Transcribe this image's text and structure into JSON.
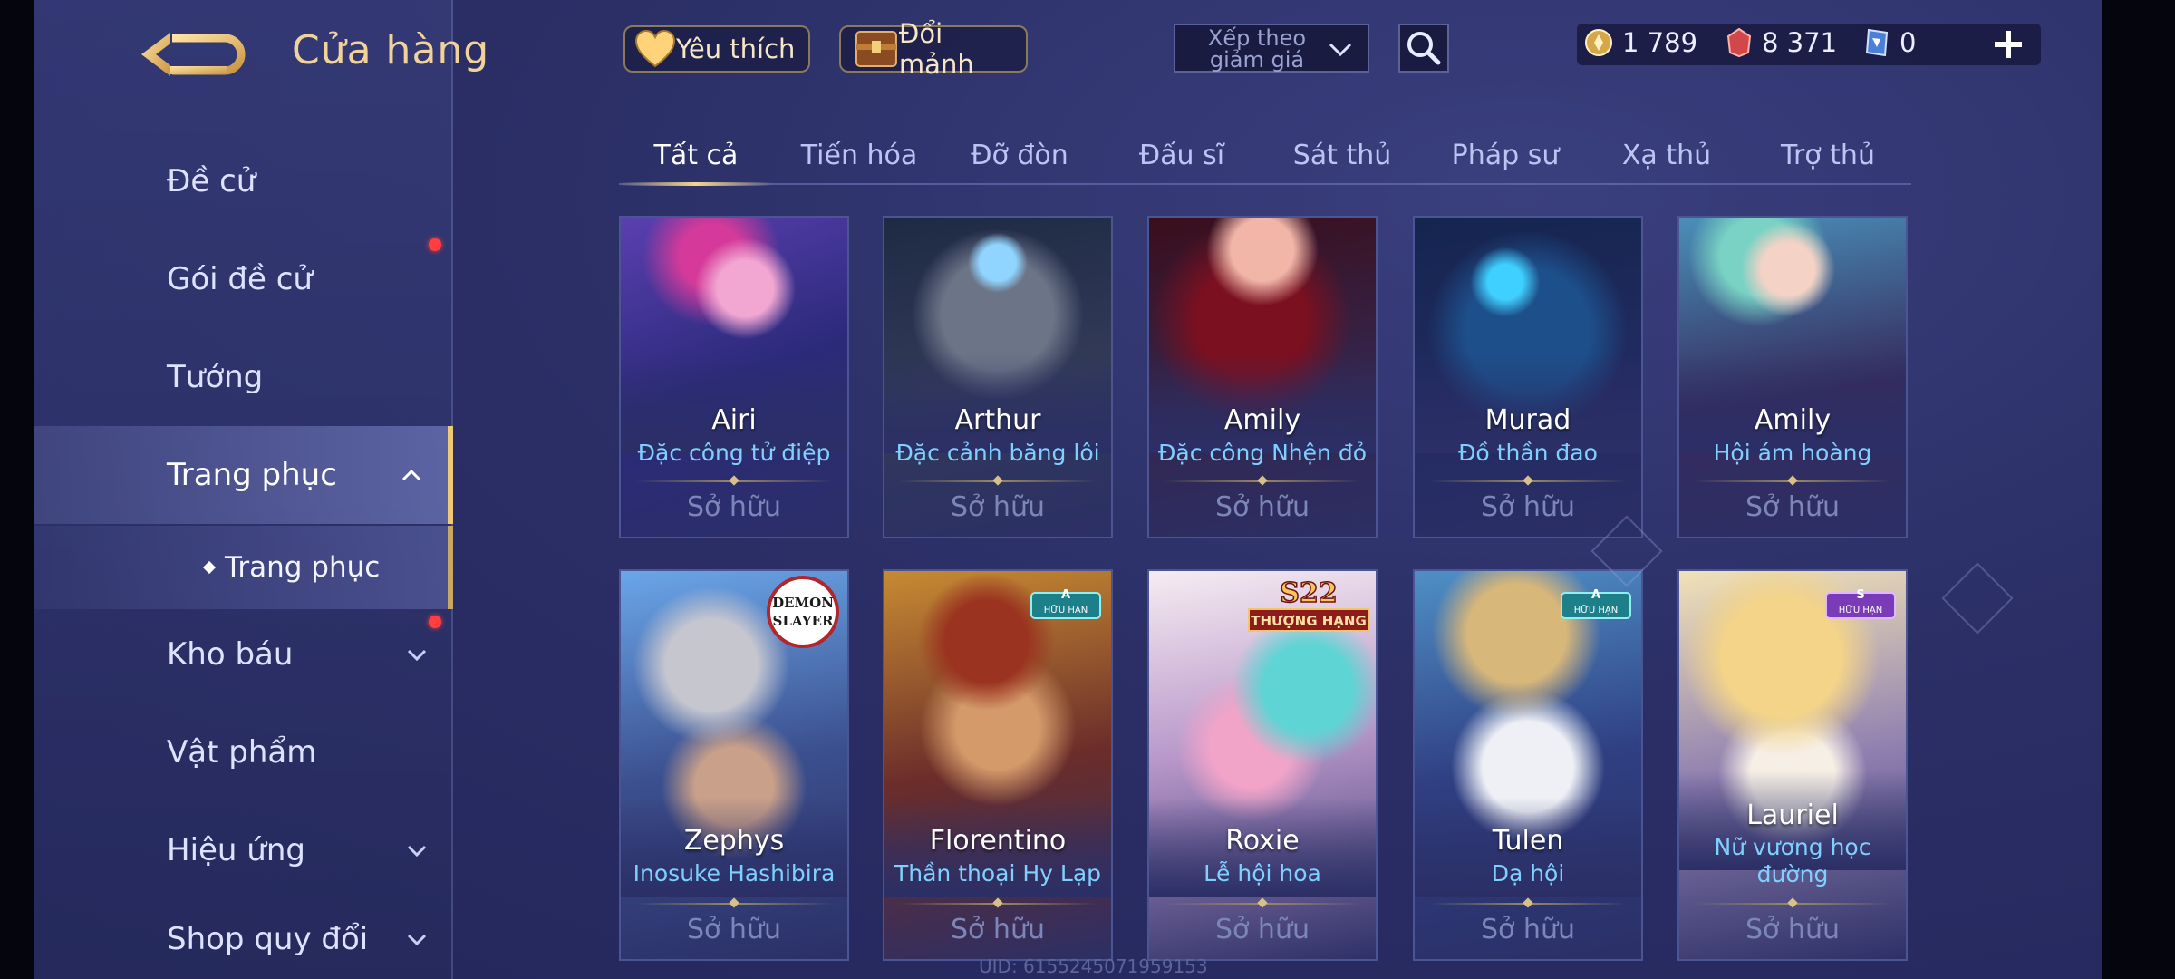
{
  "page": {
    "title": "Cửa hàng",
    "uid": "UID: 6155245071959153"
  },
  "topbar": {
    "favorites_label": "Yêu thích",
    "fragments_label": "Đổi mảnh",
    "sort_label": "Xếp theo giảm giá",
    "currencies": [
      {
        "icon": "gold-coin-icon",
        "value": "1 789"
      },
      {
        "icon": "red-voucher-icon",
        "value": "8 371"
      },
      {
        "icon": "blue-ticket-icon",
        "value": "0"
      }
    ]
  },
  "sidebar": {
    "items": [
      {
        "label": "Đề cử"
      },
      {
        "label": "Gói đề cử"
      },
      {
        "label": "Tướng"
      },
      {
        "label": "Trang phục"
      },
      {
        "label": "Kho báu"
      },
      {
        "label": "Vật phẩm"
      },
      {
        "label": "Hiệu ứng"
      },
      {
        "label": "Shop quy đổi"
      }
    ],
    "sub_item": "Trang phục"
  },
  "tabs": [
    "Tất cả",
    "Tiến hóa",
    "Đỡ đòn",
    "Đấu sĩ",
    "Sát thủ",
    "Pháp sư",
    "Xạ thủ",
    "Trợ thủ"
  ],
  "cards": [
    {
      "hero": "Airi",
      "skin": "Đặc công tử điệp",
      "status": "Sở hữu"
    },
    {
      "hero": "Arthur",
      "skin": "Đặc cảnh băng lôi",
      "status": "Sở hữu"
    },
    {
      "hero": "Amily",
      "skin": "Đặc công Nhện đỏ",
      "status": "Sở hữu"
    },
    {
      "hero": "Murad",
      "skin": "Đồ thần đao",
      "status": "Sở hữu"
    },
    {
      "hero": "Amily",
      "skin": "Hội ám hoàng",
      "status": "Sở hữu"
    },
    {
      "hero": "Zephys",
      "skin": "Inosuke Hashibira",
      "status": "Sở hữu"
    },
    {
      "hero": "Florentino",
      "skin": "Thần thoại Hy Lạp",
      "status": "Sở hữu",
      "badge_rank": "A",
      "badge_text": "HỮU HẠN"
    },
    {
      "hero": "Roxie",
      "skin": "Lễ hội hoa",
      "status": "Sở hữu",
      "badge_season": "S22",
      "badge_sub": "THƯỢNG HẠNG"
    },
    {
      "hero": "Tulen",
      "skin": "Dạ hội",
      "status": "Sở hữu",
      "badge_rank": "A",
      "badge_text": "HỮU HẠN"
    },
    {
      "hero": "Lauriel",
      "skin_line1": "Nữ vương học",
      "skin_line2": "đường",
      "status": "Sở hữu",
      "badge_rank": "S",
      "badge_text": "HỮU HẠN"
    }
  ],
  "demon_logo": {
    "line1": "DEMON",
    "line2": "SLAYER"
  },
  "colors": {
    "accent_gold": "#f0c978",
    "skin_name": "#7fd0ff",
    "owned_text": "#7d86b8",
    "red_dot": "#ff3e3e"
  }
}
